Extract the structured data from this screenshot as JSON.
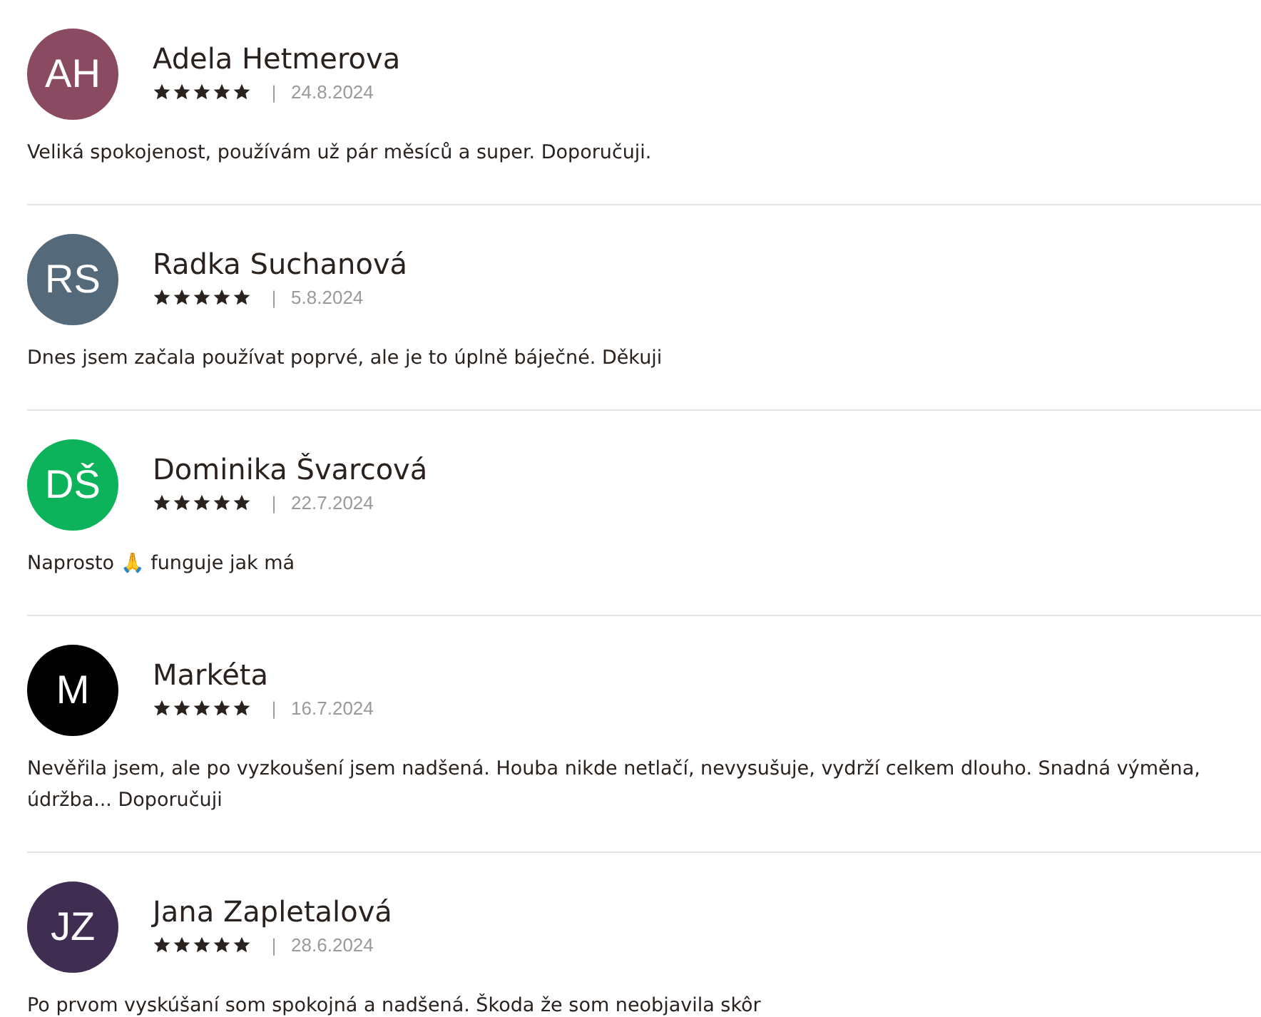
{
  "reviews": [
    {
      "initials": "AH",
      "color": "#8a4a62",
      "name": "Adela Hetmerova",
      "stars": 5,
      "separator": "|",
      "date": "24.8.2024",
      "text": "Veliká spokojenost, používám už pár měsíců a super. Doporučuji."
    },
    {
      "initials": "RS",
      "color": "#54697a",
      "name": "Radka Suchanová",
      "stars": 5,
      "separator": "|",
      "date": "5.8.2024",
      "text": "Dnes jsem začala používat poprvé, ale je to úplně báječné. Děkuji"
    },
    {
      "initials": "DŠ",
      "color": "#0db35a",
      "name": "Dominika Švarcová",
      "stars": 5,
      "separator": "|",
      "date": "22.7.2024",
      "text": "Naprosto 🙏 funguje jak má"
    },
    {
      "initials": "M",
      "color": "#000000",
      "name": "Markéta",
      "stars": 5,
      "separator": "|",
      "date": "16.7.2024",
      "text": "Nevěřila jsem, ale po vyzkoušení jsem nadšená. Houba nikde netlačí, nevysušuje, vydrží celkem dlouho. Snadná výměna, údržba... Doporučuji"
    },
    {
      "initials": "JZ",
      "color": "#3f2d52",
      "name": "Jana Zapletalová",
      "stars": 5,
      "separator": "|",
      "date": "28.6.2024",
      "text": "Po prvom vyskúšaní som spokojná a nadšená. Škoda že som neobjavila skôr"
    }
  ]
}
